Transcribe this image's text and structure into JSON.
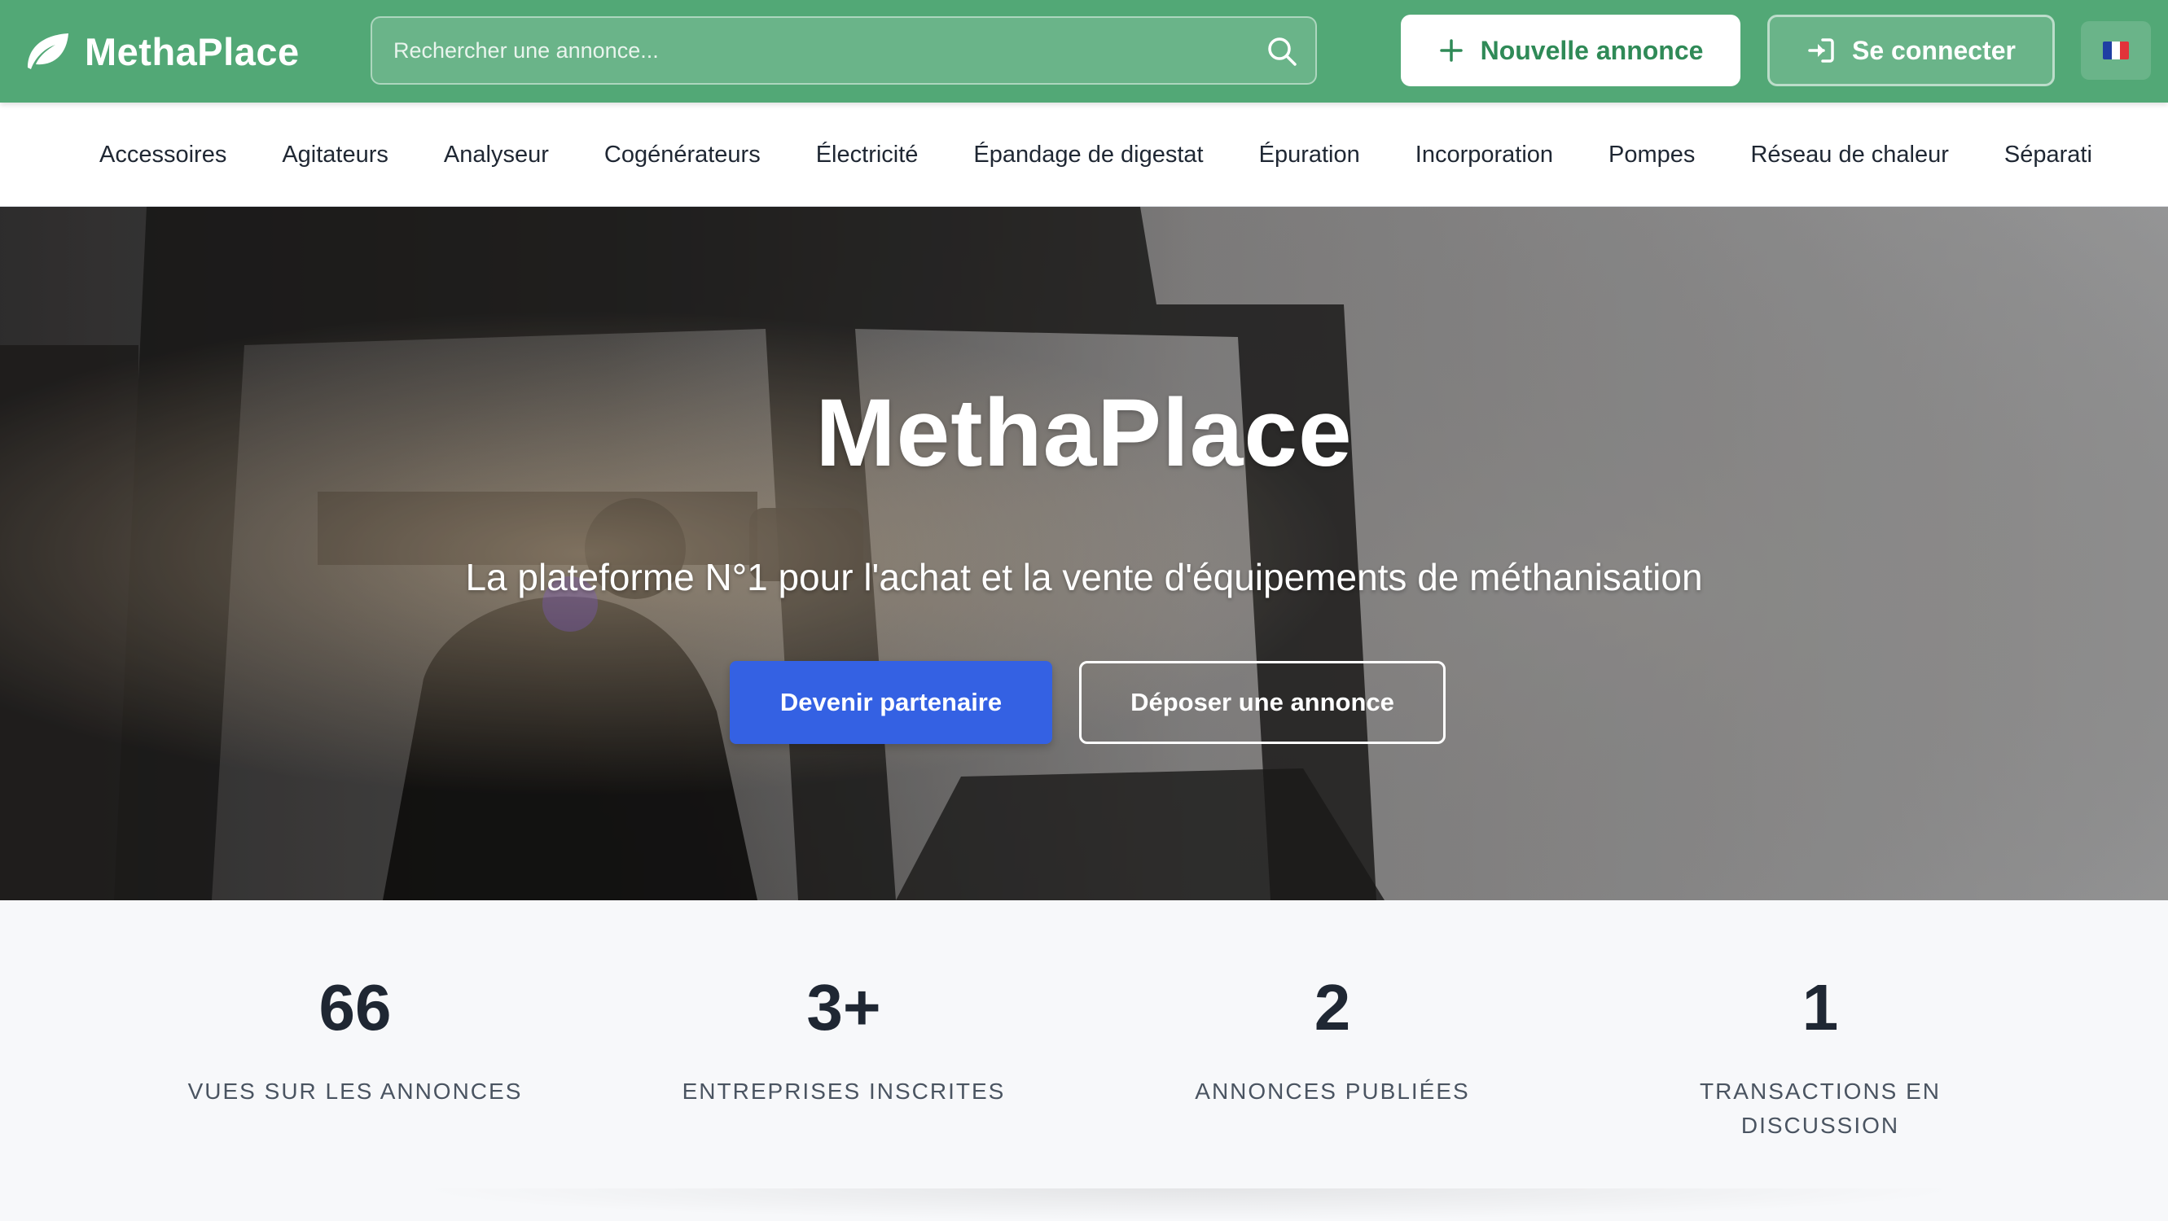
{
  "header": {
    "brand": "MethaPlace",
    "search_placeholder": "Rechercher une annonce...",
    "new_listing_label": "Nouvelle annonce",
    "login_label": "Se connecter",
    "language": "fr",
    "brand_color": "#52a876",
    "accent_text_color": "#2f8a57"
  },
  "categories": [
    "Accessoires",
    "Agitateurs",
    "Analyseur",
    "Cogénérateurs",
    "Électricité",
    "Épandage de digestat",
    "Épuration",
    "Incorporation",
    "Pompes",
    "Réseau de chaleur",
    "Séparati"
  ],
  "hero": {
    "title": "MethaPlace",
    "subtitle": "La plateforme N°1 pour l'achat et la vente d'équipements de méthanisation",
    "primary_button": "Devenir partenaire",
    "secondary_button": "Déposer une annonce",
    "primary_color": "#3461e3"
  },
  "stats": [
    {
      "value": "66",
      "label": "VUES SUR LES ANNONCES"
    },
    {
      "value": "3+",
      "label": "ENTREPRISES INSCRITES"
    },
    {
      "value": "2",
      "label": "ANNONCES PUBLIÉES"
    },
    {
      "value": "1",
      "label": "TRANSACTIONS EN DISCUSSION"
    }
  ]
}
